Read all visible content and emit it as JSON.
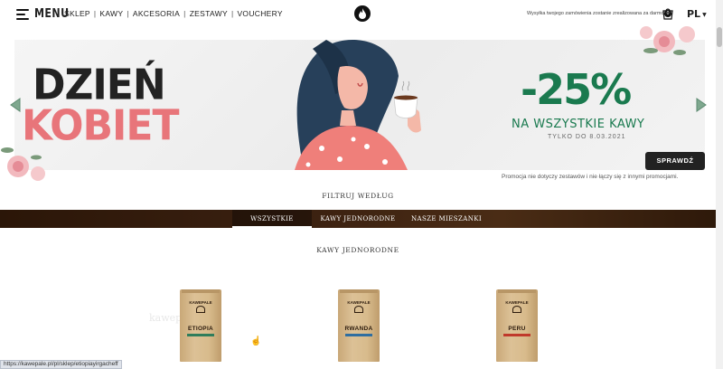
{
  "header": {
    "menu_label": "MENU",
    "nav": [
      "SKLEP",
      "KAWY",
      "AKCESORIA",
      "ZESTAWY",
      "VOUCHERY"
    ],
    "shipping_note": "Wysyłka twojego zamówienia zostanie zrealizowana za darmo.",
    "cart_count": "0",
    "language": "PL"
  },
  "banner": {
    "title_line1": "DZIEŃ",
    "title_line2": "KOBIET",
    "discount": "-25%",
    "subtitle": "NA WSZYSTKIE KAWY",
    "date_note": "TYLKO DO 8.03.2021",
    "button_label": "SPRAWDŹ",
    "colors": {
      "title": "#222222",
      "accent": "#e8757a",
      "discount": "#1a7a4f"
    }
  },
  "promo_note": "Promocja nie dotyczy zestawów i nie łączy się z innymi promocjami.",
  "filter": {
    "title": "FILTRUJ WEDŁUG",
    "tabs": [
      {
        "label": "WSZYSTKIE",
        "active": true
      },
      {
        "label": "KAWY JEDNORODNE",
        "active": false
      },
      {
        "label": "NASZE MIESZANKI",
        "active": false
      }
    ]
  },
  "section_title": "KAWY JEDNORODNE",
  "products": [
    {
      "brand": "KAWEPALE",
      "name": "ETIOPIA",
      "stripe": "#2f7d5b"
    },
    {
      "brand": "KAWEPALE",
      "name": "RWANDA",
      "stripe": "#2f6ea0"
    },
    {
      "brand": "KAWEPALE",
      "name": "PERU",
      "stripe": "#c0392b"
    }
  ],
  "ghost_text": "kawepale.com",
  "status_url": "https://kawepale.pl/pl/sklep/etiopiayirgacheff"
}
